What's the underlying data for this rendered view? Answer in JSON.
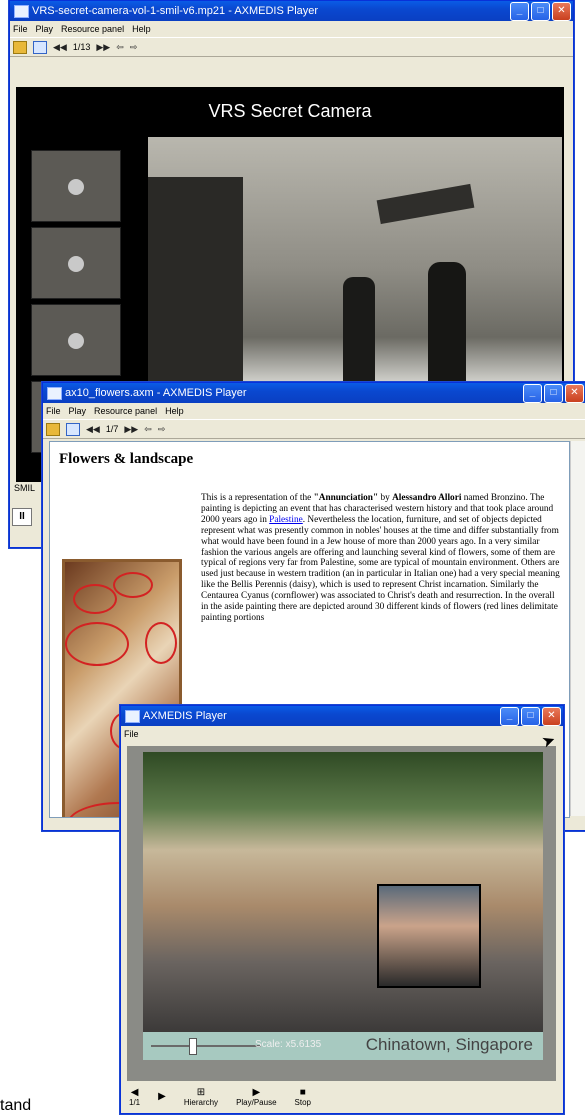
{
  "colors": {
    "titlebar": "#0a48d0",
    "window_bg": "#ece9d8",
    "close": "#c9401f"
  },
  "window1": {
    "title": "VRS-secret-camera-vol-1-smil-v6.mp21 - AXMEDIS Player",
    "menu": [
      "File",
      "Play",
      "Resource panel",
      "Help"
    ],
    "toolbar": {
      "page": "1/13"
    },
    "video_title": "VRS Secret Camera",
    "status": "SMIL",
    "pause_label": "II"
  },
  "window2": {
    "title": "ax10_flowers.axm - AXMEDIS Player",
    "menu": [
      "File",
      "Play",
      "Resource panel",
      "Help"
    ],
    "toolbar": {
      "page": "1/7"
    },
    "heading": "Flowers & landscape",
    "paragraph_pre": "This is a representation of the ",
    "paragraph_bold1": "\"Annunciation\"",
    "paragraph_mid": " by ",
    "paragraph_bold2": "Alessandro Allori",
    "paragraph_post1": " named Bronzino. The painting is depicting an event that has characterised western history and that took place around 2000 years ago in ",
    "paragraph_link": "Palestine",
    "paragraph_post2": ". Nevertheless the location, furniture, and set of objects depicted represent what was presently common in nobles' houses at the time and differ substantially from what would have been found in a Jew house of more than 2000 years ago. In a very similar fashion the various angels are offering and launching several kind of flowers, some of them are typical of regions very far from Palestine, some are typical of mountain environment. Others are used just because in western tradition (an in particular in Italian one) had a very special meaning like the Bellis Perennis (daisy), which is used to represent Christ incarnation. Similarly the Centaurea Cyanus (cornflower) was associated to Christ's death and resurrection. In the overall in the aside painting there are depicted around 30 different kinds of flowers (red lines delimitate painting portions"
  },
  "window3": {
    "title": "AXMEDIS Player",
    "menu": [
      "File"
    ],
    "scale_label": "Scale: x5.6135",
    "caption": "Chinatown, Singapore",
    "bottom": [
      {
        "icon": "◀",
        "label": "1/1"
      },
      {
        "icon": "▶",
        "label": ""
      },
      {
        "icon": "⊞",
        "label": "Hierarchy"
      },
      {
        "icon": "▶",
        "label": "Play/Pause"
      },
      {
        "icon": "■",
        "label": "Stop"
      }
    ]
  },
  "footer_text": "tand"
}
